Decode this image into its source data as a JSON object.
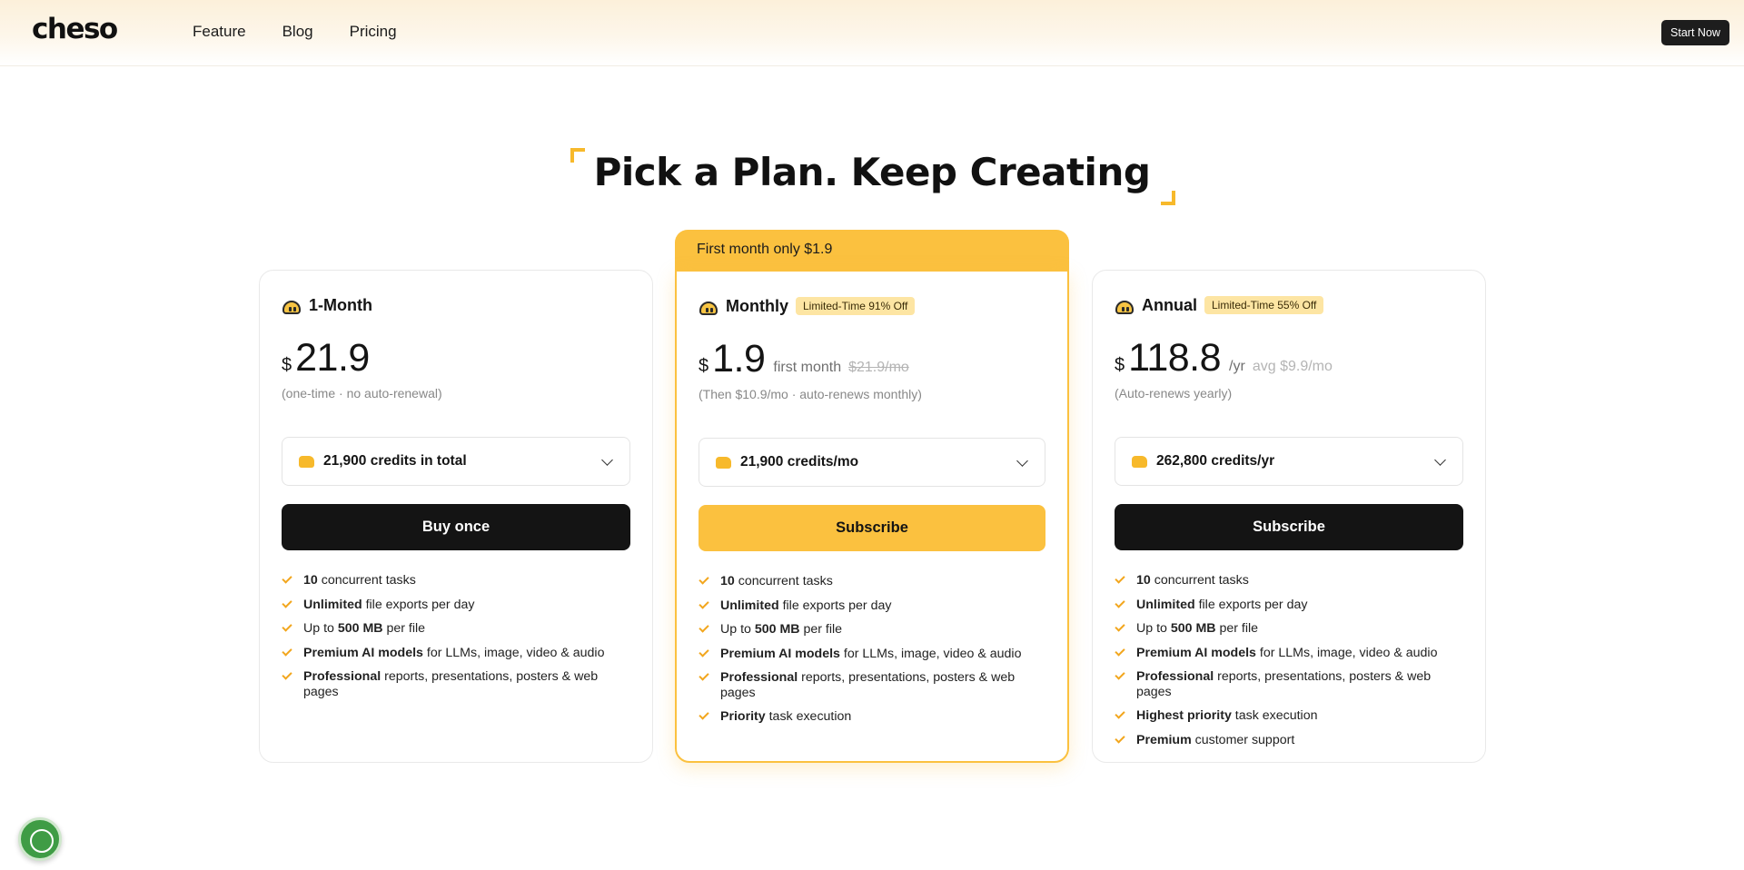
{
  "header": {
    "logo": "cheso",
    "nav": [
      "Feature",
      "Blog",
      "Pricing"
    ],
    "cta": "Start Now"
  },
  "title": "Pick a Plan. Keep Creating",
  "colors": {
    "accent": "#fbc13f",
    "dark": "#141414",
    "check": "#f2a61d"
  },
  "featured_ribbon": "First month only $1.9",
  "plans": [
    {
      "name": "1-Month",
      "icon": "mascot-icon",
      "currency": "$",
      "price": "21.9",
      "per": "",
      "strike": "",
      "avg": "",
      "note": "(one-time · no auto-renewal)",
      "credits": "21,900 credits in total",
      "cta": "Buy once",
      "features": [
        [
          "10",
          " concurrent tasks",
          ""
        ],
        [
          "Unlimited",
          " file exports per day",
          ""
        ],
        [
          "",
          "Up to ",
          "500 MB",
          " per file"
        ],
        [
          "Premium AI models",
          " for LLMs, image, video & audio",
          ""
        ],
        [
          "Professional",
          " reports, presentations, posters & web pages",
          ""
        ]
      ]
    },
    {
      "name": "Monthly",
      "icon": "mascot-wink-icon",
      "tag": "Limited-Time 91% Off",
      "currency": "$",
      "price": "1.9",
      "per": "first month",
      "strike": "$21.9/mo",
      "avg": "",
      "note": "(Then $10.9/mo · auto-renews monthly)",
      "credits": "21,900 credits/mo",
      "cta": "Subscribe",
      "features": [
        [
          "10",
          " concurrent tasks",
          ""
        ],
        [
          "Unlimited",
          " file exports per day",
          ""
        ],
        [
          "",
          "Up to ",
          "500 MB",
          " per file"
        ],
        [
          "Premium AI models",
          " for LLMs, image, video & audio",
          ""
        ],
        [
          "Professional",
          " reports, presentations, posters & web pages",
          ""
        ],
        [
          "Priority",
          " task execution",
          ""
        ]
      ]
    },
    {
      "name": "Annual",
      "icon": "mascot-crown-icon",
      "tag": "Limited-Time 55% Off",
      "currency": "$",
      "price": "118.8",
      "per": "/yr",
      "strike": "",
      "avg": "avg $9.9/mo",
      "note": "(Auto-renews yearly)",
      "credits": "262,800 credits/yr",
      "cta": "Subscribe",
      "features": [
        [
          "10",
          " concurrent tasks",
          ""
        ],
        [
          "Unlimited",
          " file exports per day",
          ""
        ],
        [
          "",
          "Up to ",
          "500 MB",
          " per file"
        ],
        [
          "Premium AI models",
          " for LLMs, image, video & audio",
          ""
        ],
        [
          "Professional",
          " reports, presentations, posters & web pages",
          ""
        ],
        [
          "Highest priority",
          " task execution",
          ""
        ],
        [
          "Premium",
          " customer support",
          ""
        ]
      ]
    }
  ]
}
